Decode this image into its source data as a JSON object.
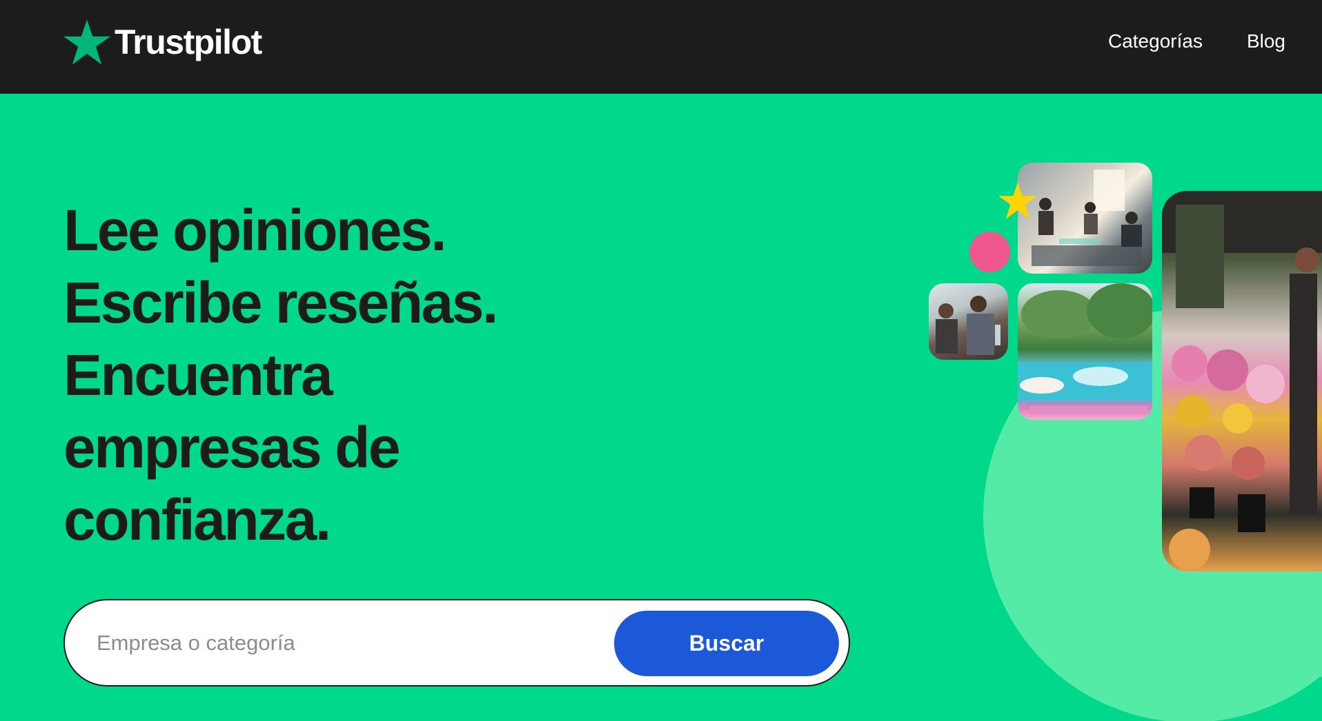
{
  "header": {
    "brand": "Trustpilot",
    "nav": [
      {
        "label": "Categorías"
      },
      {
        "label": "Blog"
      }
    ],
    "colors": {
      "background": "#1c1c1c",
      "logo_star": "#00b67a",
      "text": "#ffffff"
    }
  },
  "hero": {
    "headline_lines": [
      "Lee opiniones.",
      "Escribe reseñas.",
      "Encuentra",
      "empresas de",
      "confianza."
    ],
    "search": {
      "placeholder": "Empresa o categoría",
      "value": "",
      "button_label": "Buscar"
    },
    "colors": {
      "background": "#00d98b",
      "accent_blob": "#54eba6",
      "button": "#1c59d8",
      "pink_dot": "#f0568e",
      "yellow_star": "#ffd400"
    },
    "images": [
      {
        "name": "office-photo"
      },
      {
        "name": "friends-photo"
      },
      {
        "name": "pool-photo"
      },
      {
        "name": "flower-shop-photo"
      }
    ]
  }
}
